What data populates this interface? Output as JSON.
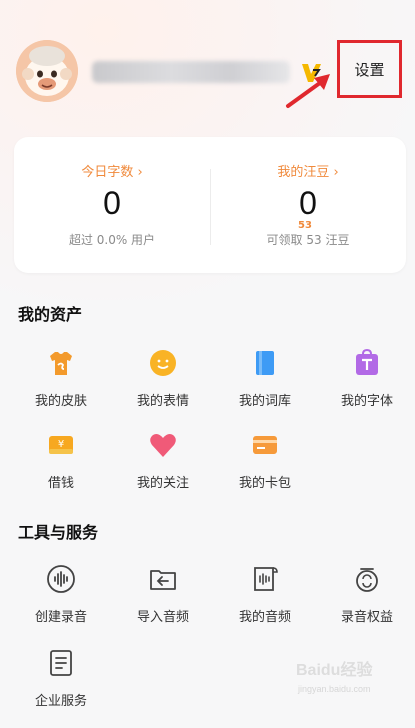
{
  "header": {
    "settings_label": "设置"
  },
  "stats": {
    "today_words_title": "今日字数 ›",
    "today_words_value": "0",
    "today_words_sub": "超过 0.0% 用户",
    "wang_beans_title": "我的汪豆 ›",
    "wang_beans_value": "0",
    "wang_beans_bubble": "53",
    "wang_beans_sub": "可领取 53 汪豆"
  },
  "assets": {
    "title": "我的资产",
    "items": [
      {
        "label": "我的皮肤",
        "icon": "shirt-icon"
      },
      {
        "label": "我的表情",
        "icon": "smile-icon"
      },
      {
        "label": "我的词库",
        "icon": "book-icon"
      },
      {
        "label": "我的字体",
        "icon": "font-bag-icon"
      },
      {
        "label": "借钱",
        "icon": "yen-card-icon"
      },
      {
        "label": "我的关注",
        "icon": "heart-icon"
      },
      {
        "label": "我的卡包",
        "icon": "card-icon"
      }
    ]
  },
  "tools": {
    "title": "工具与服务",
    "items": [
      {
        "label": "创建录音",
        "icon": "mic-wave-icon"
      },
      {
        "label": "导入音频",
        "icon": "import-folder-icon"
      },
      {
        "label": "我的音频",
        "icon": "audio-doc-icon"
      },
      {
        "label": "录音权益",
        "icon": "recording-rights-icon"
      },
      {
        "label": "企业服务",
        "icon": "enterprise-doc-icon"
      }
    ]
  },
  "watermark": {
    "brand": "Baidu经验",
    "url": "jingyan.baidu.com"
  },
  "colors": {
    "accent_orange": "#f08a3c",
    "highlight_red": "#e0282e",
    "heart_pink": "#f05a78",
    "purple": "#b26ae6",
    "blue": "#3e9bf5"
  }
}
